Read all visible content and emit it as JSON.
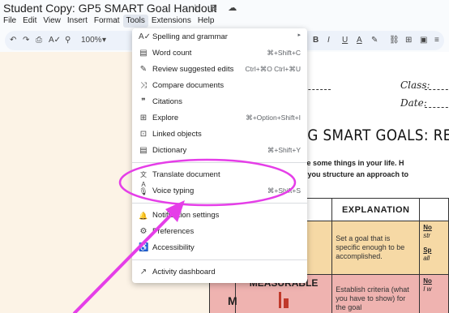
{
  "document": {
    "title": "Student Copy: GP5 SMART Goal Handout",
    "title_icons": "☆ ⊡ ☁"
  },
  "menubar": {
    "items": [
      "File",
      "Edit",
      "View",
      "Insert",
      "Format",
      "Tools",
      "Extensions",
      "Help"
    ],
    "active": "Tools"
  },
  "toolbar": {
    "undo": "↶",
    "redo": "↷",
    "print": "⎙",
    "spellcheck": "A✓",
    "paint_format": "⚲",
    "zoom": "100%",
    "zoom_caret": "▾",
    "bold": "B",
    "italic": "I",
    "underline": "U",
    "text_color": "A",
    "highlight": "✎",
    "link": "⛓",
    "comment": "⊞",
    "image": "▣",
    "align": "≡"
  },
  "page": {
    "class_label": "Class:",
    "date_label": "Date:",
    "heading": "TTING SMART GOALS: REV",
    "intro_line1": "want to change some things in your life. H",
    "intro_line2": "RT goal helps you structure an approach to",
    "table": {
      "header_explanation": "EXPLANATION",
      "s_explanation": "Set a goal that is specific enough to be accomplished.",
      "s_note1_label": "No",
      "s_note1_text": "str",
      "s_note2_label": "Sp",
      "s_note2_text": "all",
      "measurable_label": "MEASURABLE",
      "m_letter": "M",
      "m_explanation": "Establish criteria (what you have to show) for the goal",
      "m_note1_label": "No",
      "m_note1_text": "I w"
    }
  },
  "tools_menu": {
    "items": [
      {
        "label": "Spelling and grammar",
        "shortcut": "",
        "icon": "spellcheck-icon",
        "glyph": "A✓",
        "submenu": "▸"
      },
      {
        "label": "Word count",
        "shortcut": "⌘+Shift+C",
        "icon": "word-count-icon",
        "glyph": "▤"
      },
      {
        "label": "Review suggested edits",
        "shortcut": "Ctrl+⌘O Ctrl+⌘U",
        "icon": "review-edits-icon",
        "glyph": "✎"
      },
      {
        "label": "Compare documents",
        "shortcut": "",
        "icon": "compare-icon",
        "glyph": "⤨"
      },
      {
        "label": "Citations",
        "shortcut": "",
        "icon": "citations-icon",
        "glyph": "❞"
      },
      {
        "label": "Explore",
        "shortcut": "⌘+Option+Shift+I",
        "icon": "explore-icon",
        "glyph": "⊞"
      },
      {
        "label": "Linked objects",
        "shortcut": "",
        "icon": "linked-objects-icon",
        "glyph": "⊡"
      },
      {
        "label": "Dictionary",
        "shortcut": "⌘+Shift+Y",
        "icon": "dictionary-icon",
        "glyph": "▤"
      },
      {
        "label": "Translate document",
        "shortcut": "",
        "icon": "translate-icon",
        "glyph": "文A"
      },
      {
        "label": "Voice typing",
        "shortcut": "⌘+Shift+S",
        "icon": "microphone-icon",
        "glyph": "🎙"
      },
      {
        "label": "Notification settings",
        "shortcut": "",
        "icon": "bell-icon",
        "glyph": "🔔"
      },
      {
        "label": "Preferences",
        "shortcut": "",
        "icon": "preferences-icon",
        "glyph": "⚙"
      },
      {
        "label": "Accessibility",
        "shortcut": "",
        "icon": "accessibility-icon",
        "glyph": "♿"
      },
      {
        "label": "Activity dashboard",
        "shortcut": "",
        "icon": "activity-icon",
        "glyph": "↗"
      }
    ]
  },
  "colors": {
    "annotation": "#e53ee8",
    "app_background": "#f9fbfd",
    "toolbar": "#edf2fa",
    "canvas": "#fcf3e6",
    "row_specific": "#f6d9a5",
    "row_measurable": "#efb3b0"
  }
}
